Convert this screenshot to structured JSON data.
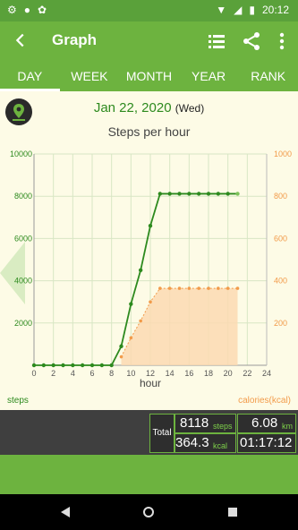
{
  "status": {
    "time": "20:12"
  },
  "appbar": {
    "title": "Graph",
    "back_icon": "arrow-back-icon",
    "list_icon": "list-icon",
    "share_icon": "share-icon",
    "more_icon": "more-vert-icon"
  },
  "tabs": [
    {
      "label": "DAY",
      "active": true
    },
    {
      "label": "WEEK"
    },
    {
      "label": "MONTH"
    },
    {
      "label": "YEAR"
    },
    {
      "label": "RANK"
    }
  ],
  "header": {
    "date": "Jan 22, 2020",
    "dow": "(Wed)",
    "chart_title": "Steps per hour"
  },
  "chart_data": {
    "type": "line",
    "title": "Steps per hour",
    "xlabel": "hour",
    "ylabel_left": "steps",
    "ylabel_right": "calories(kcal)",
    "x_ticks": [
      0,
      2,
      4,
      6,
      8,
      10,
      12,
      14,
      16,
      18,
      20,
      22,
      24
    ],
    "y_left_ticks": [
      2000,
      4000,
      6000,
      8000,
      10000
    ],
    "y_right_ticks": [
      200,
      400,
      600,
      800,
      1000
    ],
    "xlim": [
      0,
      24
    ],
    "ylim_left": [
      0,
      10000
    ],
    "ylim_right": [
      0,
      1000
    ],
    "series": [
      {
        "name": "steps",
        "axis": "left",
        "color": "#2d8a1e",
        "x": [
          0,
          1,
          2,
          3,
          4,
          5,
          6,
          7,
          8,
          9,
          10,
          11,
          12,
          13,
          14,
          15,
          16,
          17,
          18,
          19,
          20,
          21
        ],
        "y": [
          0,
          0,
          0,
          0,
          0,
          0,
          0,
          0,
          0,
          900,
          2900,
          4500,
          6600,
          8118,
          8118,
          8118,
          8118,
          8118,
          8118,
          8118,
          8118,
          8118
        ]
      },
      {
        "name": "calories",
        "axis": "right",
        "color": "#f29b4a",
        "x": [
          9,
          10,
          11,
          12,
          13,
          14,
          15,
          16,
          17,
          18,
          19,
          20,
          21
        ],
        "y": [
          40,
          130,
          210,
          300,
          364,
          364,
          364,
          364,
          364,
          364,
          364,
          364,
          364
        ]
      }
    ]
  },
  "footer": {
    "steps_label": "steps",
    "calories_label": "calories(kcal)"
  },
  "summary": {
    "total_label": "Total",
    "steps": "8118",
    "steps_unit": "steps",
    "distance": "6.08",
    "distance_unit": "km",
    "kcal": "364.3",
    "kcal_unit": "kcal",
    "duration": "01:17:12"
  }
}
